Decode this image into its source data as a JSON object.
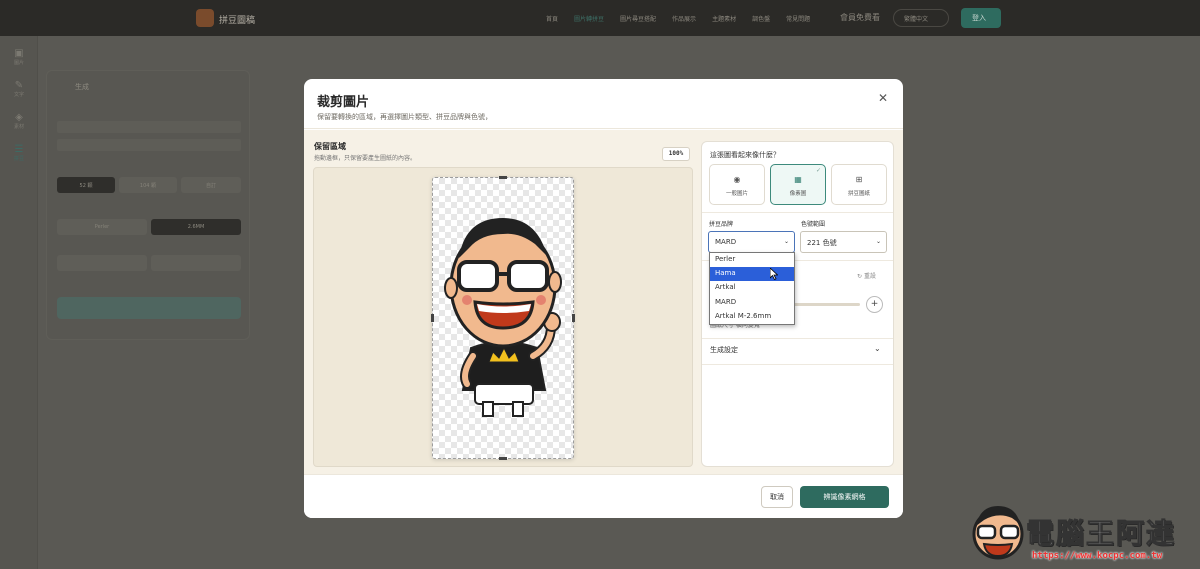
{
  "app": {
    "name": "拼豆圖稿",
    "nav": [
      "首頁",
      "圖片轉拼豆",
      "圖片尋豆搭配",
      "作品展示",
      "主題素材",
      "調色盤",
      "常見問題"
    ],
    "nav_vip": "會員免費看",
    "lang": "繁體中文",
    "login": "登入"
  },
  "sidebar": [
    "圖片",
    "文字",
    "素材",
    "拼豆"
  ],
  "panel": {
    "title": "生成",
    "chips": [
      "52 顆",
      "104 顆",
      "自訂",
      "Perler",
      "2.6MM"
    ]
  },
  "modal": {
    "title": "裁剪圖片",
    "subtitle": "保留要轉換的區域，再選擇圖片類型、拼豆品牌與色號，",
    "crop": {
      "title": "保留區域",
      "hint": "拖動邊框，只保留要產生圖紙的內容。",
      "zoom": "100%"
    },
    "question": "這張圖看起來像什麼？",
    "types": [
      {
        "label": "一般圖片",
        "icon": "camera-icon",
        "selected": false
      },
      {
        "label": "像素圖",
        "icon": "grid-icon",
        "selected": true
      },
      {
        "label": "拼豆圖紙",
        "icon": "pattern-icon",
        "selected": false
      }
    ],
    "brand": {
      "label": "拼豆品牌",
      "value": "MARD",
      "options": [
        "Perler",
        "Hama",
        "Artkal",
        "MARD",
        "Artkal M-2.6mm"
      ],
      "hovered": "Hama"
    },
    "color_range": {
      "label": "色號範圍",
      "value": "221 色號"
    },
    "reset": "重設",
    "size_note": "圖紙尺寸 橫向變寬",
    "gen_settings": "生成設定",
    "cancel": "取消",
    "confirm": "辨識像素網格"
  },
  "watermark": {
    "text": "電腦王阿達",
    "url": "https://www.kocpc.com.tw"
  },
  "colors": {
    "accent": "#2e6b5f",
    "select_focus": "#4b74b8",
    "hover": "#2b5fd9"
  }
}
